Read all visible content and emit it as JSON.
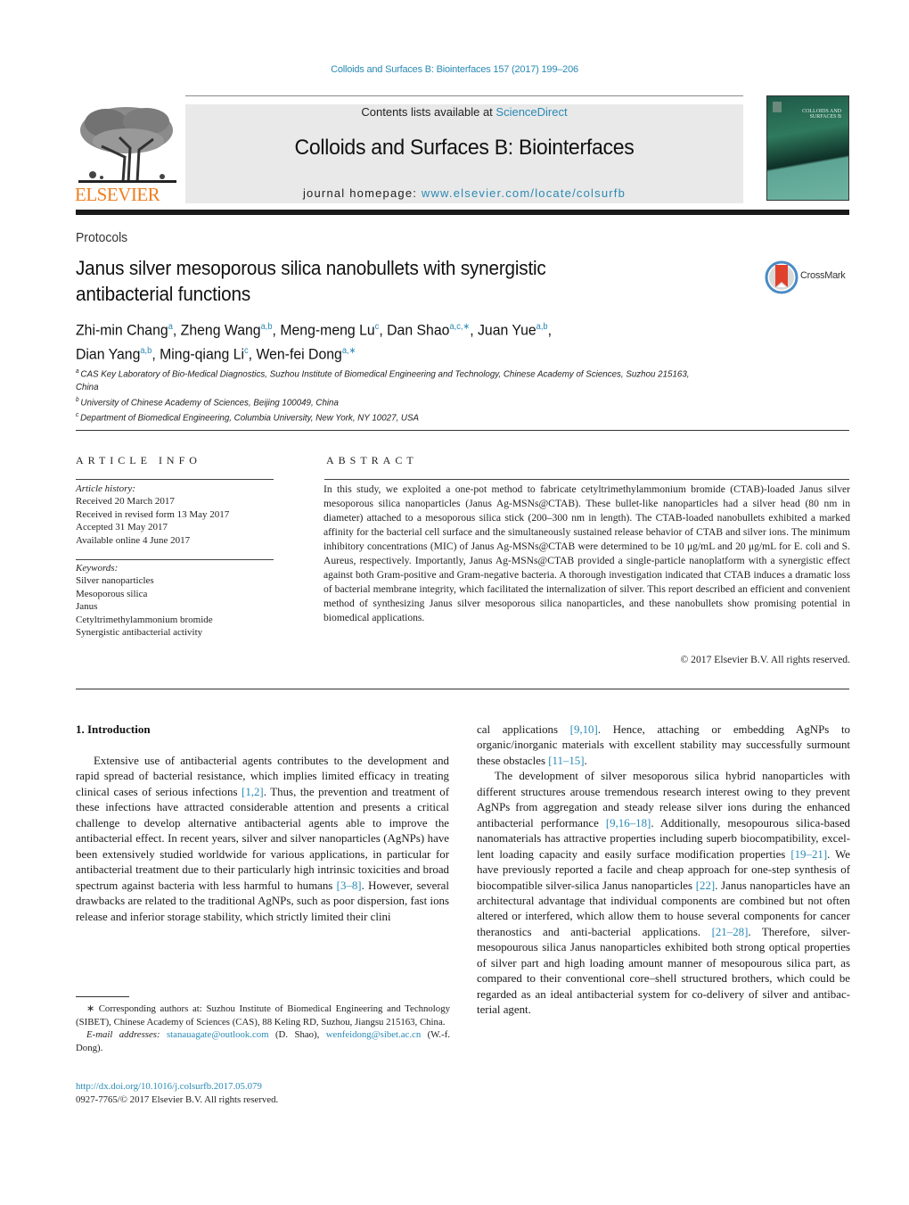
{
  "header": {
    "journal_citation": "Colloids and Surfaces B: Biointerfaces 157 (2017) 199–206",
    "contents_prefix": "Contents lists available at ",
    "contents_link": "ScienceDirect",
    "journal_title": "Colloids and Surfaces B: Biointerfaces",
    "homepage_prefix": "journal homepage: ",
    "homepage_link": "www.elsevier.com/locate/colsurfb",
    "publisher_wordmark": "ELSEVIER",
    "publisher_logo_icon": "elsevier-tree-icon",
    "cover_icon": "journal-cover-image",
    "cover_title_line1": "COLLOIDS AND",
    "cover_title_line2": "SURFACES B",
    "colors": {
      "link": "#2a8ab5",
      "elsevier_orange": "#f07e1e",
      "masthead_bg": "#e9e9e9"
    }
  },
  "article": {
    "type": "Protocols",
    "title_line1": "Janus silver mesoporous silica nanobullets with synergistic",
    "title_line2": "antibacterial functions",
    "crossmark_label": "CrossMark",
    "authors": [
      {
        "name": "Zhi-min Chang",
        "sup": "a"
      },
      {
        "name": "Zheng Wang",
        "sup": "a,b"
      },
      {
        "name": "Meng-meng Lu",
        "sup": "c"
      },
      {
        "name": "Dan Shao",
        "sup": "a,c,∗"
      },
      {
        "name": "Juan Yue",
        "sup": "a,b"
      },
      {
        "name": "Dian Yang",
        "sup": "a,b"
      },
      {
        "name": "Ming-qiang Li",
        "sup": "c"
      },
      {
        "name": "Wen-fei Dong",
        "sup": "a,∗"
      }
    ],
    "affiliations": [
      {
        "key": "a",
        "text": "CAS Key Laboratory of Bio-Medical Diagnostics, Suzhou Institute of Biomedical Engineering and Technology, Chinese Academy of Sciences, Suzhou 215163, China"
      },
      {
        "key": "b",
        "text": "University of Chinese Academy of Sciences, Beijing 100049, China"
      },
      {
        "key": "c",
        "text": "Department of Biomedical Engineering, Columbia University, New York, NY 10027, USA"
      }
    ]
  },
  "article_info": {
    "heading": "ARTICLE INFO",
    "history_label": "Article history:",
    "history": [
      "Received 20 March 2017",
      "Received in revised form 13 May 2017",
      "Accepted 31 May 2017",
      "Available online 4 June 2017"
    ],
    "keywords_label": "Keywords:",
    "keywords": [
      "Silver nanoparticles",
      "Mesoporous silica",
      "Janus",
      "Cetyltrimethylammonium bromide",
      "Synergistic antibacterial activity"
    ]
  },
  "abstract": {
    "heading": "ABSTRACT",
    "text": "In this study, we exploited a one-pot method to fabricate cetyltrimethylammonium bromide (CTAB)-loaded Janus silver mesoporous silica nanoparticles (Janus Ag-MSNs@CTAB). These bullet-like nanoparticles had a silver head (80 nm in diameter) attached to a mesoporous silica stick (200–300 nm in length). The CTAB-loaded nanobullets exhibited a marked affinity for the bacterial cell surface and the simultaneously sustained release behavior of CTAB and silver ions. The minimum inhibitory con­centrations (MIC) of Janus Ag-MSNs@CTAB were determined to be 10 μg/mL and 20 μg/mL for E. coli and S. Aureus, respectively. Importantly, Janus Ag-MSNs@CTAB provided a single-particle nanoplatform with a synergistic effect against both Gram-positive and Gram-negative bacteria. A thorough investiga­tion indicated that CTAB induces a dramatic loss of bacterial membrane integrity, which facilitated the internalization of silver. This report described an efficient and convenient method of synthesizing Janus silver mesoporous silica nanoparticles, and these nanobullets show promising potential in biomedical applications.",
    "copyright": "© 2017 Elsevier B.V. All rights reserved."
  },
  "body": {
    "section_heading": "1.  Introduction",
    "left_paragraph": [
      {
        "t": "Extensive use of antibacterial agents contributes to the develop­ment and rapid spread of bacterial resistance, which implies limited efficacy in treating clinical cases of serious infections "
      },
      {
        "c": "[1,2]"
      },
      {
        "t": ". Thus, the prevention and treatment of these infections have attracted considerable attention and presents a critical challenge to develop alternative antibacterial agents able to improve the antibacterial effect. In recent years, silver and silver nanoparticles (AgNPs) have been extensively studied worldwide for various applications, in particular for antibacterial treatment due to their particularly high intrinsic toxicities and broad spectrum against bacteria with less harmful to humans "
      },
      {
        "c": "[3–8]"
      },
      {
        "t": ". However, several drawbacks are related to the traditional AgNPs, such as poor dispersion, fast ions release and inferior storage stability, which strictly limited their clini­"
      }
    ],
    "right_paragraph_1": [
      {
        "t": "cal applications "
      },
      {
        "c": "[9,10]"
      },
      {
        "t": ". Hence, attaching or embedding AgNPs to organic/inorganic materials with excellent stability may success­fully surmount these obstacles "
      },
      {
        "c": "[11–15]"
      },
      {
        "t": "."
      }
    ],
    "right_paragraph_2": [
      {
        "t": "The development of silver mesoporous silica hybrid nanoparti­cles with different structures arouse tremendous research interest owing to they prevent AgNPs from aggregation and steady release silver ions during the enhanced antibacterial performance "
      },
      {
        "c": "[9,16–18]"
      },
      {
        "t": ". Additionally, mesopourous silica-based nanomaterials has attractive properties including superb biocompatibility, excel­lent loading capacity and easily surface modification properties "
      },
      {
        "c": "[19–21]"
      },
      {
        "t": ". We have previously reported a facile and cheap approach for one-step synthesis of biocompatible silver-silica Janus nanopar­ticles "
      },
      {
        "c": "[22]"
      },
      {
        "t": ". Janus nanoparticles have an architectural advantage that individual components are combined but not often altered or interfered, which allow them to house several components for cancer theranostics and anti-bacterial applications. "
      },
      {
        "c": "[21–28]"
      },
      {
        "t": ". There­fore, silver-mesopourous silica Janus nanoparticles exhibited both strong optical properties of silver part and high loading amount manner of mesopourous silica part, as compared to their conven­tional core–shell structured brothers, which could be regarded as an ideal antibacterial system for co-delivery of silver and antibac­terial agent."
      }
    ]
  },
  "footnotes": {
    "corresponding": "∗  Corresponding authors at: Suzhou Institute of Biomedical Engineering and Tech­nology (SIBET), Chinese Academy of Sciences (CAS), 88 Keling RD, Suzhou, Jiangsu 215163, China.",
    "email_label": "E-mail addresses: ",
    "email_1": "stanauagate@outlook.com",
    "email_1_owner": " (D. Shao), ",
    "email_2": "wenfeidong@sibet.ac.cn",
    "email_2_owner": " (W.-f. Dong).",
    "doi": "http://dx.doi.org/10.1016/j.colsurfb.2017.05.079",
    "issn_copyright": "0927-7765/© 2017 Elsevier B.V. All rights reserved."
  }
}
